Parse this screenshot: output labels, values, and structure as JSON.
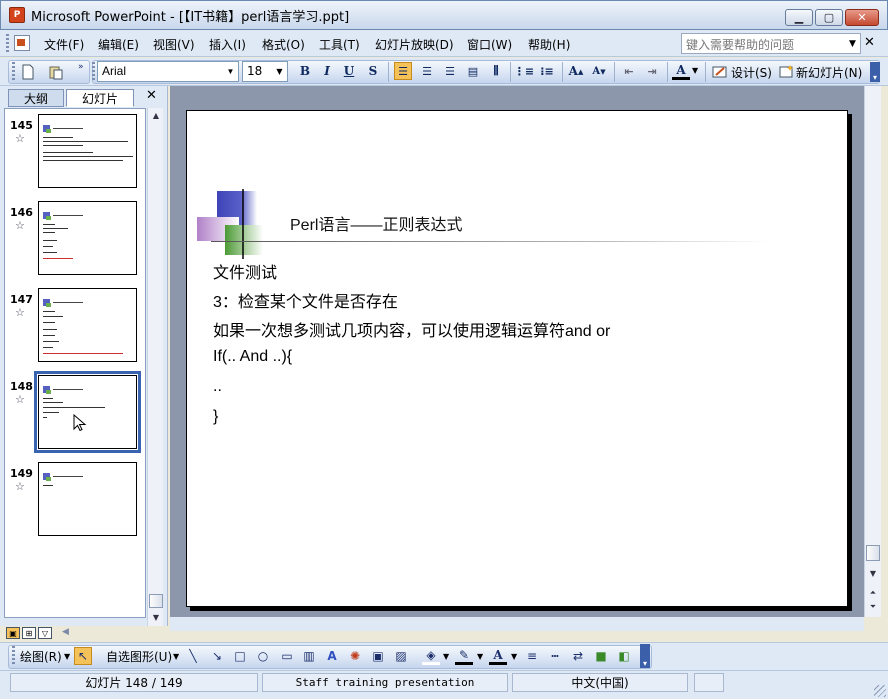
{
  "window": {
    "title": "Microsoft PowerPoint - [【IT书籍】perl语言学习.ppt]",
    "app_icon": "powerpoint-icon"
  },
  "menu": {
    "items": [
      "文件(F)",
      "编辑(E)",
      "视图(V)",
      "插入(I)",
      "格式(O)",
      "工具(T)",
      "幻灯片放映(D)",
      "窗口(W)",
      "帮助(H)"
    ],
    "help_placeholder": "键入需要帮助的问题"
  },
  "toolbar": {
    "font": "Arial",
    "size": "18",
    "bold": "B",
    "italic": "I",
    "underline": "U",
    "shadow": "S",
    "design_label": "设计(S)",
    "new_slide_label": "新幻灯片(N)"
  },
  "panel": {
    "tabs": [
      "大纲",
      "幻灯片"
    ],
    "slides": [
      {
        "number": "145"
      },
      {
        "number": "146"
      },
      {
        "number": "147"
      },
      {
        "number": "148"
      },
      {
        "number": "149"
      }
    ],
    "selected_index": 3
  },
  "slide": {
    "title": "Perl语言——正则表达式",
    "lines": [
      "文件测试",
      "3：检查某个文件是否存在",
      "如果一次想多测试几项内容，可以使用逻辑运算符and or",
      "If(.. And ..){",
      "..",
      "}"
    ]
  },
  "drawing": {
    "draw_label": "绘图(R)",
    "autoshape_label": "自选图形(U)"
  },
  "status": {
    "slide_pos": "幻灯片 148 / 149",
    "design": "Staff training presentation",
    "language": "中文(中国)"
  },
  "colors": {
    "chrome": "#dfe9f5",
    "edit_bg": "#8c97ab",
    "accent": "#3a64b0",
    "active": "#f5c25a"
  }
}
